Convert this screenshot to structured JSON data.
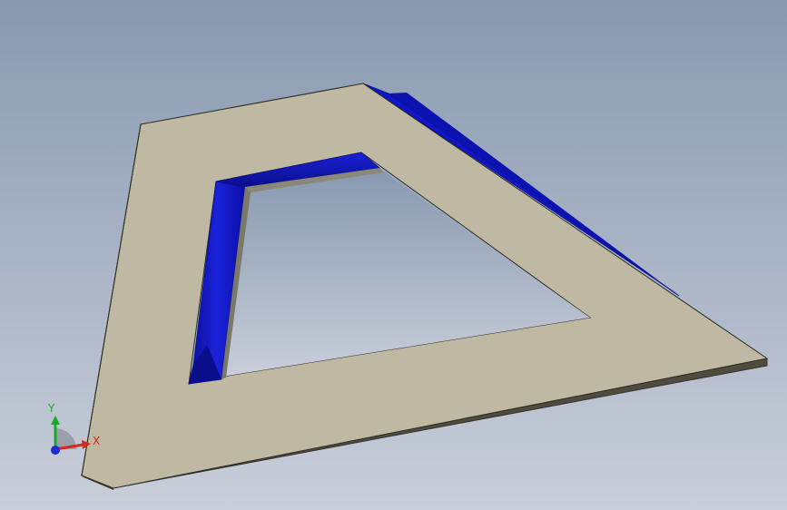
{
  "viewport": {
    "background_top": "#8899b0",
    "background_bottom": "#c9ceda"
  },
  "part": {
    "face_color": "#bfb8a2",
    "side_color": "#5a5647",
    "edge_color": "#2a2a22",
    "highlight_color": "#1016c8",
    "highlight_dark": "#0a0e8a",
    "inner_wall_color": "#7a7868"
  },
  "triad": {
    "x_label": "X",
    "y_label": "Y",
    "x_color": "#d42a1a",
    "y_color": "#1aa82a",
    "z_color": "#1a2ad4"
  }
}
